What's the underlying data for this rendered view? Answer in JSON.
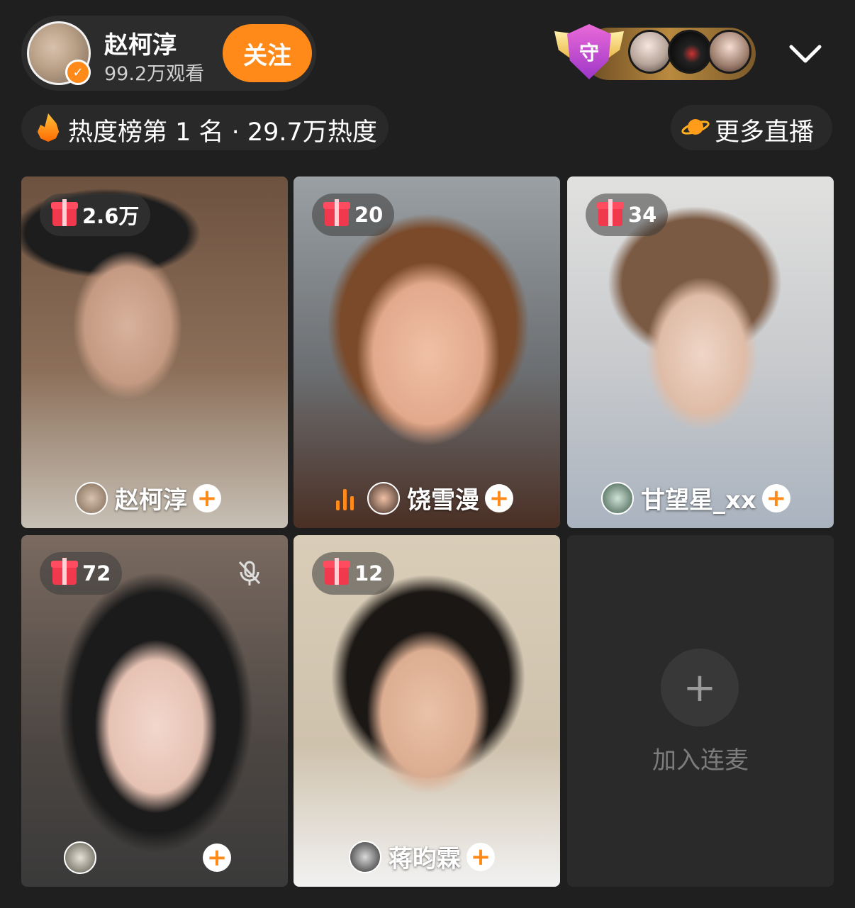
{
  "header": {
    "host_name": "赵柯淳",
    "views": "99.2万观看",
    "follow_label": "关注",
    "guard_label": "守"
  },
  "heat": {
    "text": "热度榜第 1 名 · 29.7万热度"
  },
  "more_live": {
    "label": "更多直播"
  },
  "tiles": [
    {
      "gift_count": "2.6万",
      "name": "赵柯淳"
    },
    {
      "gift_count": "20",
      "name": "饶雪漫"
    },
    {
      "gift_count": "34",
      "name": "甘望星_xx"
    },
    {
      "gift_count": "72",
      "name": ""
    },
    {
      "gift_count": "12",
      "name": "蒋昀霖"
    }
  ],
  "join": {
    "label": "加入连麦"
  },
  "colors": {
    "accent": "#ff8a1a",
    "background": "#1f1f1f"
  }
}
